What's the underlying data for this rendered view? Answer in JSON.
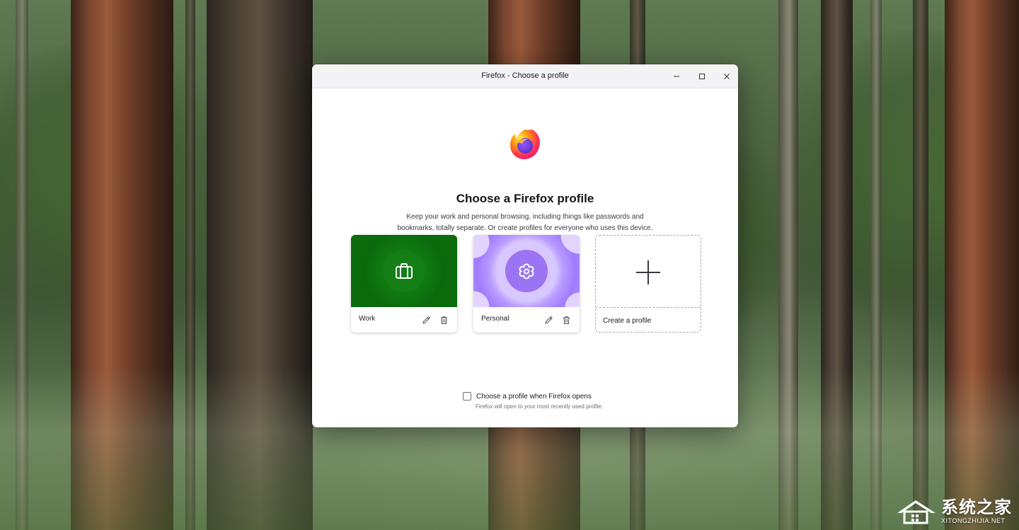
{
  "window": {
    "title": "Firefox - Choose a profile",
    "controls": [
      "minimize-icon",
      "maximize-icon",
      "close-icon"
    ]
  },
  "main": {
    "logo": "firefox-logo",
    "heading": "Choose a Firefox profile",
    "description_line1": "Keep your work and personal browsing, including things like passwords and",
    "description_line2": "bookmarks, totally separate. Or create profiles for everyone who uses this device."
  },
  "profiles": [
    {
      "name": "Work",
      "icon": "briefcase-icon",
      "theme_color": "#0f7a10"
    },
    {
      "name": "Personal",
      "icon": "flower-icon",
      "theme_color": "#a17bff"
    }
  ],
  "create_card": {
    "label": "Create a profile",
    "icon": "plus-icon"
  },
  "startup_option": {
    "label": "Choose a profile when Firefox opens",
    "sublabel": "Firefox will open to your most recently used profile.",
    "checked": false
  },
  "card_actions": {
    "edit_icon": "pencil-icon",
    "delete_icon": "trash-icon"
  },
  "watermark": {
    "cn": "系统之家",
    "en": "XITONGZHIJIA.NET"
  }
}
